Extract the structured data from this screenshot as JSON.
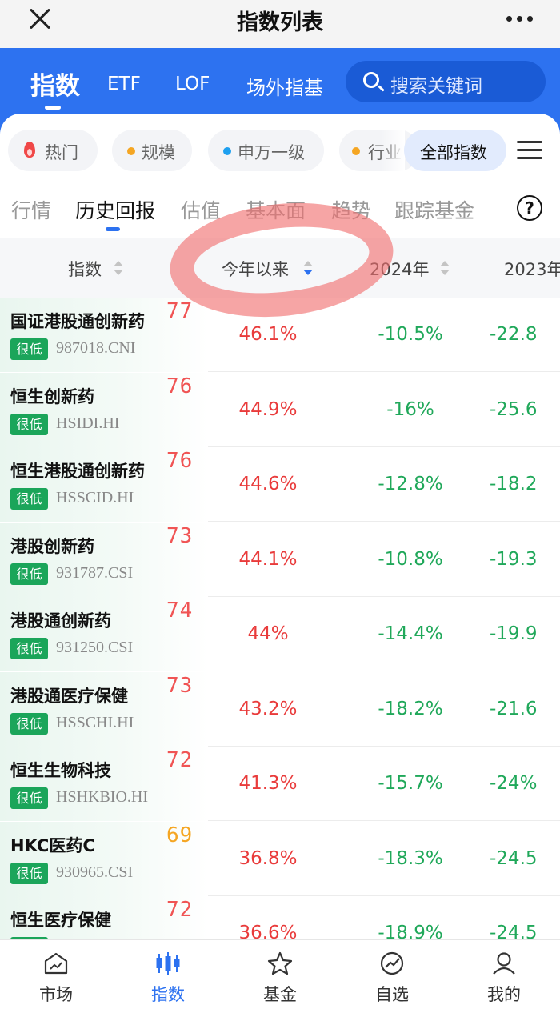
{
  "titlebar": {
    "title": "指数列表"
  },
  "top_tabs": {
    "tab1": "指数",
    "tab2": "ETF",
    "tab3": "LOF",
    "tab4": "场外指基"
  },
  "search": {
    "placeholder": "搜索关键词"
  },
  "chips": {
    "hot": "热门",
    "scale": "规模",
    "sw": "申万一级",
    "industry": "行业",
    "all": "全部指数"
  },
  "sub_tabs": {
    "s1": "行情",
    "s2": "历史回报",
    "s3": "估值",
    "s4": "基本面",
    "s5": "趋势",
    "s6": "跟踪基金",
    "help": "?"
  },
  "table": {
    "headers": {
      "index": "指数",
      "ytd": "今年以来",
      "y2024": "2024年",
      "y2023": "2023年"
    },
    "badge": "很低",
    "rows": [
      {
        "name": "国证港股通创新药",
        "code": "987018.CNI",
        "score": "77",
        "ytd": "46.1%",
        "y2024": "-10.5%",
        "y2023": "-22.8"
      },
      {
        "name": "恒生创新药",
        "code": "HSIDI.HI",
        "score": "76",
        "ytd": "44.9%",
        "y2024": "-16%",
        "y2023": "-25.6"
      },
      {
        "name": "恒生港股通创新药",
        "code": "HSSCID.HI",
        "score": "76",
        "ytd": "44.6%",
        "y2024": "-12.8%",
        "y2023": "-18.2"
      },
      {
        "name": "港股创新药",
        "code": "931787.CSI",
        "score": "73",
        "ytd": "44.1%",
        "y2024": "-10.8%",
        "y2023": "-19.3"
      },
      {
        "name": "港股通创新药",
        "code": "931250.CSI",
        "score": "74",
        "ytd": "44%",
        "y2024": "-14.4%",
        "y2023": "-19.9"
      },
      {
        "name": "港股通医疗保健",
        "code": "HSSCHI.HI",
        "score": "73",
        "ytd": "43.2%",
        "y2024": "-18.2%",
        "y2023": "-21.6"
      },
      {
        "name": "恒生生物科技",
        "code": "HSHKBIO.HI",
        "score": "72",
        "ytd": "41.3%",
        "y2024": "-15.7%",
        "y2023": "-24%"
      },
      {
        "name": "HKC医药C",
        "code": "930965.CSI",
        "score": "69",
        "ytd": "36.8%",
        "y2024": "-18.3%",
        "y2023": "-24.5"
      },
      {
        "name": "恒生医疗保健",
        "code": "",
        "score": "72",
        "ytd": "36.6%",
        "y2024": "-18.9%",
        "y2023": "-24.5"
      }
    ]
  },
  "colors": {
    "brand_blue": "#2d72f0",
    "up_red": "#e93b3b",
    "down_green": "#20a85a",
    "badge_green": "#1ba55a"
  },
  "bottom_nav": {
    "market": "市场",
    "index": "指数",
    "fund": "基金",
    "watchlist": "自选",
    "me": "我的"
  }
}
